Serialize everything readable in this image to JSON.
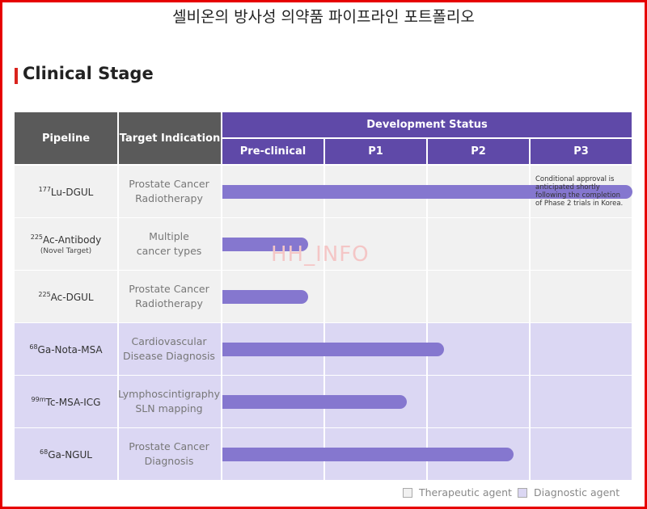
{
  "page": {
    "title": "셀비온의 방사성 의약품 파이프라인 포트폴리오"
  },
  "section": {
    "title": "Clinical Stage"
  },
  "header": {
    "pipeline": "Pipeline",
    "indication": "Target Indication",
    "status": "Development Status",
    "phases": [
      "Pre-clinical",
      "P1",
      "P2",
      "P3"
    ]
  },
  "rows": [
    {
      "iso": "177",
      "name": "Lu-DGUL",
      "sub": "",
      "indication": [
        "Prostate Cancer",
        "Radiotherapy"
      ],
      "type": "therapeutic",
      "progress_fraction_of_p3": 1.0,
      "note": "Conditional approval is anticipated shortly following the completion of Phase 2 trials in Korea."
    },
    {
      "iso": "225",
      "name": "Ac-Antibody",
      "sub": "(Novel Target)",
      "indication": [
        "Multiple",
        "cancer types"
      ],
      "type": "therapeutic",
      "progress_fraction_of_p3": 0.21
    },
    {
      "iso": "225",
      "name": "Ac-DGUL",
      "sub": "",
      "indication": [
        "Prostate Cancer",
        "Radiotherapy"
      ],
      "type": "therapeutic",
      "progress_fraction_of_p3": 0.21
    },
    {
      "iso": "68",
      "name": "Ga-Nota-MSA",
      "sub": "",
      "indication": [
        "Cardiovascular",
        "Disease Diagnosis"
      ],
      "type": "diagnostic",
      "progress_fraction_of_p3": 0.54
    },
    {
      "iso": "99m",
      "name": "Tc-MSA-ICG",
      "sub": "",
      "indication": [
        "Lymphoscintigraphy",
        "SLN mapping"
      ],
      "type": "diagnostic",
      "progress_fraction_of_p3": 0.45
    },
    {
      "iso": "68",
      "name": "Ga-NGUL",
      "sub": "",
      "indication": [
        "Prostate Cancer",
        "Diagnosis"
      ],
      "type": "diagnostic",
      "progress_fraction_of_p3": 0.71
    }
  ],
  "legend": {
    "therapeutic": "Therapeutic agent",
    "diagnostic": "Diagnostic agent"
  },
  "watermark": "HH_INFO",
  "colors": {
    "header_dark": "#5a5a5a",
    "header_purple": "#5f49a8",
    "bar": "#8577cf",
    "therapeutic_bg": "#f1f1f1",
    "diagnostic_bg": "#dbd7f3",
    "section_marker": "#d9231d"
  }
}
